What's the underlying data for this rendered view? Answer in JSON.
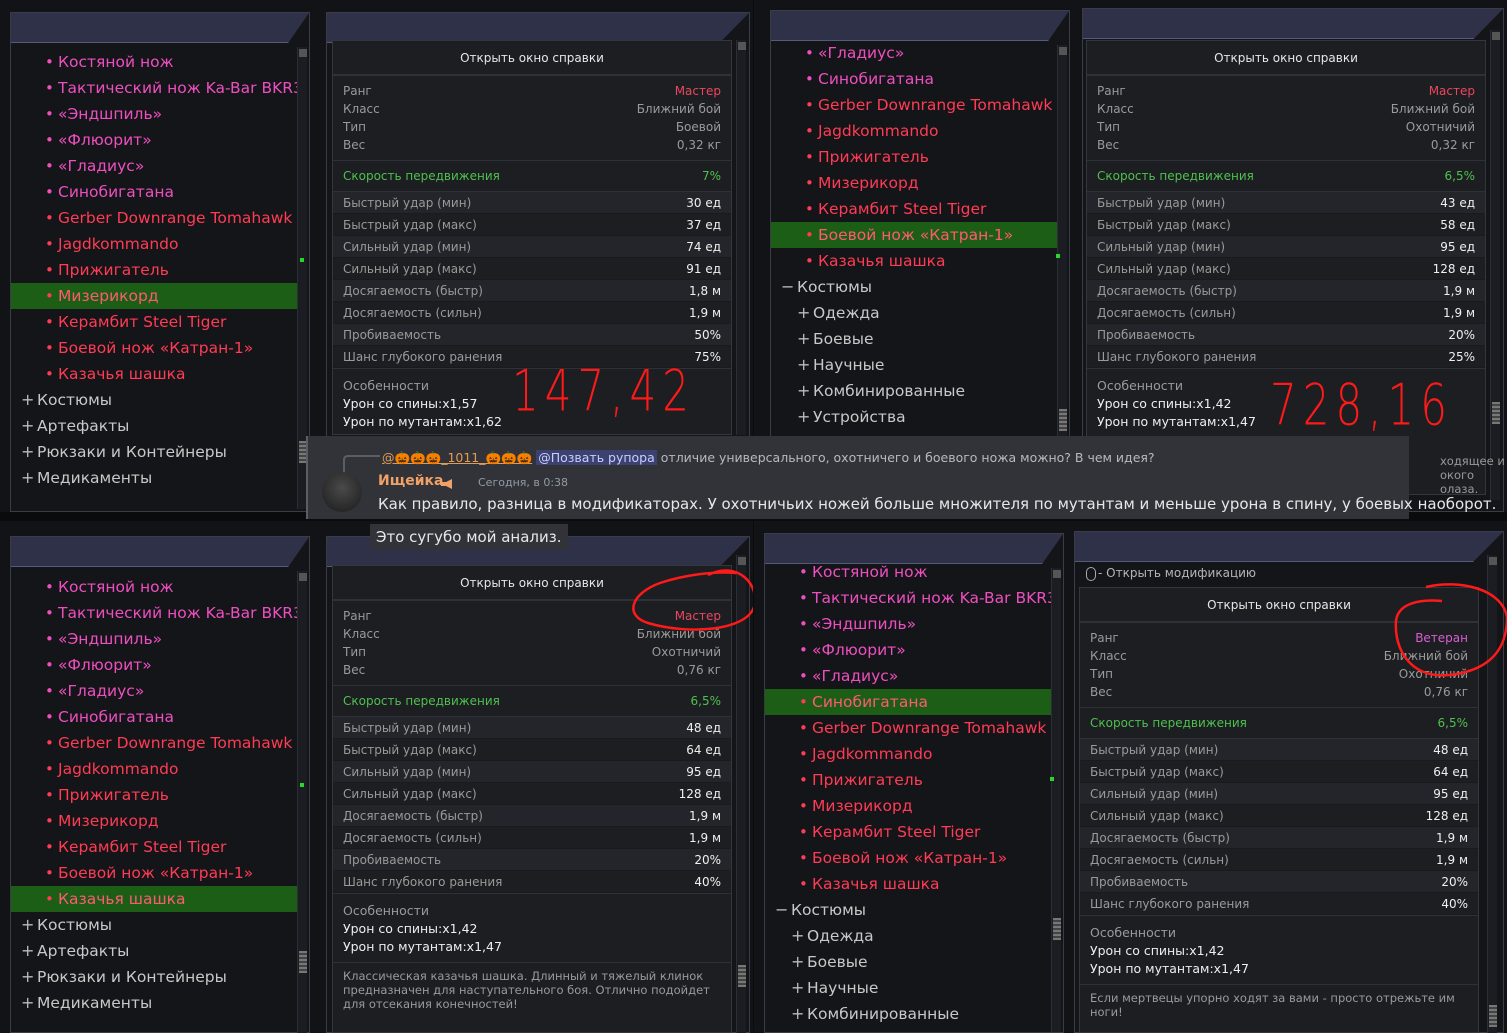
{
  "chat": {
    "reply_author": "@🎃🎃🎃_1011_🎃🎃🎃",
    "reply_mention": "@Позвать рупора",
    "reply_text": "отличие универсального, охотничего и боевого ножа можно? В чем идея?",
    "username": "Ищейка",
    "timestamp": "Сегодня, в 0:38",
    "message": "Как правило, разница в модификаторах. У охотничьих ножей больше множителя по мутантам и меньше урона в спину, у боевых наоборот.",
    "message2": "Это сугубо мой анализ."
  },
  "labels": {
    "open_help": "Открыть окно справки",
    "open_mod": "- Открыть модификацию",
    "rank": "Ранг",
    "class": "Класс",
    "type": "Тип",
    "weight": "Вес",
    "speed": "Скорость передвижения",
    "fast_min": "Быстрый удар (мин)",
    "fast_max": "Быстрый удар (макс)",
    "strong_min": "Сильный удар (мин)",
    "strong_max": "Сильный удар (макс)",
    "reach_fast": "Досягаемость (быстр)",
    "reach_strong": "Досягаемость (сильн)",
    "pierce": "Пробиваемость",
    "bleed": "Шанс глубокого ранения",
    "features": "Особенности",
    "back": "Урон со спины:",
    "mutants": "Урон по мутантам:"
  },
  "panels": {
    "tl": {
      "list": [
        {
          "t": "Костяной нож",
          "c": "pink"
        },
        {
          "t": "Тактический нож Ka-Bar BKR3",
          "c": "pink"
        },
        {
          "t": "«Эндшпиль»",
          "c": "pink"
        },
        {
          "t": "«Флюорит»",
          "c": "pink"
        },
        {
          "t": "«Гладиус»",
          "c": "pink"
        },
        {
          "t": "Синобигатана",
          "c": "pink"
        },
        {
          "t": "Gerber Downrange Tomahawk",
          "c": "red"
        },
        {
          "t": "Jagdkommando",
          "c": "red"
        },
        {
          "t": "Прижигатель",
          "c": "red"
        },
        {
          "t": "Мизерикорд",
          "c": "sel"
        },
        {
          "t": "Керамбит Steel Tiger",
          "c": "red"
        },
        {
          "t": "Боевой нож «Катран-1»",
          "c": "red"
        },
        {
          "t": "Казачья шашка",
          "c": "red"
        },
        {
          "t": "Костюмы",
          "c": "cat",
          "pm": "+"
        },
        {
          "t": "Артефакты",
          "c": "cat",
          "pm": "+"
        },
        {
          "t": "Рюкзаки и Контейнеры",
          "c": "cat",
          "pm": "+"
        },
        {
          "t": "Медикаменты",
          "c": "cat",
          "pm": "+"
        }
      ],
      "rank": "Мастер",
      "class": "Ближний бой",
      "type": "Боевой",
      "weight": "0,32 кг",
      "speed": "7%",
      "stats": [
        "30 ед",
        "37 ед",
        "74 ед",
        "91 ед",
        "1,8 м",
        "1,9 м",
        "50%",
        "75%"
      ],
      "back": "x1,57",
      "mutants": "x1,62",
      "note": "147,42"
    },
    "tr": {
      "list": [
        {
          "t": "«Гладиус»",
          "c": "pink"
        },
        {
          "t": "Синобигатана",
          "c": "pink"
        },
        {
          "t": "Gerber Downrange Tomahawk",
          "c": "red"
        },
        {
          "t": "Jagdkommando",
          "c": "red"
        },
        {
          "t": "Прижигатель",
          "c": "red"
        },
        {
          "t": "Мизерикорд",
          "c": "red"
        },
        {
          "t": "Керамбит Steel Tiger",
          "c": "red"
        },
        {
          "t": "Боевой нож «Катран-1»",
          "c": "sel"
        },
        {
          "t": "Казачья шашка",
          "c": "red"
        },
        {
          "t": "Костюмы",
          "c": "cat",
          "pm": "−"
        },
        {
          "t": "Одежда",
          "c": "sub",
          "pm": "+"
        },
        {
          "t": "Боевые",
          "c": "sub",
          "pm": "+"
        },
        {
          "t": "Научные",
          "c": "sub",
          "pm": "+"
        },
        {
          "t": "Комбинированные",
          "c": "sub",
          "pm": "+"
        },
        {
          "t": "Устройства",
          "c": "sub",
          "pm": "+"
        }
      ],
      "rank": "Мастер",
      "class": "Ближний бой",
      "type": "Охотничий",
      "weight": "0,32 кг",
      "speed": "6,5%",
      "stats": [
        "43 ед",
        "58 ед",
        "95 ед",
        "128 ед",
        "1,9 м",
        "1,9 м",
        "20%",
        "25%"
      ],
      "back": "x1,42",
      "mutants": "x1,47",
      "note": "728,16",
      "desc_frag": "ходящее и\nокого\nолаза."
    },
    "bl": {
      "list": [
        {
          "t": "Костяной нож",
          "c": "pink"
        },
        {
          "t": "Тактический нож Ka-Bar BKR3",
          "c": "pink"
        },
        {
          "t": "«Эндшпиль»",
          "c": "pink"
        },
        {
          "t": "«Флюорит»",
          "c": "pink"
        },
        {
          "t": "«Гладиус»",
          "c": "pink"
        },
        {
          "t": "Синобигатана",
          "c": "pink"
        },
        {
          "t": "Gerber Downrange Tomahawk",
          "c": "red"
        },
        {
          "t": "Jagdkommando",
          "c": "red"
        },
        {
          "t": "Прижигатель",
          "c": "red"
        },
        {
          "t": "Мизерикорд",
          "c": "red"
        },
        {
          "t": "Керамбит Steel Tiger",
          "c": "red"
        },
        {
          "t": "Боевой нож «Катран-1»",
          "c": "red"
        },
        {
          "t": "Казачья шашка",
          "c": "sel"
        },
        {
          "t": "Костюмы",
          "c": "cat",
          "pm": "+"
        },
        {
          "t": "Артефакты",
          "c": "cat",
          "pm": "+"
        },
        {
          "t": "Рюкзаки и Контейнеры",
          "c": "cat",
          "pm": "+"
        },
        {
          "t": "Медикаменты",
          "c": "cat",
          "pm": "+"
        }
      ],
      "rank": "Мастер",
      "class": "Ближний бой",
      "type": "Охотничий",
      "weight": "0,76 кг",
      "speed": "6,5%",
      "stats": [
        "48 ед",
        "64 ед",
        "95 ед",
        "128 ед",
        "1,9 м",
        "1,9 м",
        "20%",
        "40%"
      ],
      "back": "x1,42",
      "mutants": "x1,47",
      "desc": "Классическая казачья шашка. Длинный и тяжелый клинок предназначен для наступательного боя. Отлично подойдет для отсекания конечностей!"
    },
    "br": {
      "list": [
        {
          "t": "Костяной нож",
          "c": "pink"
        },
        {
          "t": "Тактический нож Ka-Bar BKR3",
          "c": "pink"
        },
        {
          "t": "«Эндшпиль»",
          "c": "pink"
        },
        {
          "t": "«Флюорит»",
          "c": "pink"
        },
        {
          "t": "«Гладиус»",
          "c": "pink"
        },
        {
          "t": "Синобигатана",
          "c": "sel"
        },
        {
          "t": "Gerber Downrange Tomahawk",
          "c": "red"
        },
        {
          "t": "Jagdkommando",
          "c": "red"
        },
        {
          "t": "Прижигатель",
          "c": "red"
        },
        {
          "t": "Мизерикорд",
          "c": "red"
        },
        {
          "t": "Керамбит Steel Tiger",
          "c": "red"
        },
        {
          "t": "Боевой нож «Катран-1»",
          "c": "red"
        },
        {
          "t": "Казачья шашка",
          "c": "red"
        },
        {
          "t": "Костюмы",
          "c": "cat",
          "pm": "−"
        },
        {
          "t": "Одежда",
          "c": "sub",
          "pm": "+"
        },
        {
          "t": "Боевые",
          "c": "sub",
          "pm": "+"
        },
        {
          "t": "Научные",
          "c": "sub",
          "pm": "+"
        },
        {
          "t": "Комбинированные",
          "c": "sub",
          "pm": "+"
        }
      ],
      "rank": "Ветеран",
      "class": "Ближний бой",
      "type": "Охотничий",
      "weight": "0,76 кг",
      "speed": "6,5%",
      "stats": [
        "48 ед",
        "64 ед",
        "95 ед",
        "128 ед",
        "1,9 м",
        "1,9 м",
        "20%",
        "40%"
      ],
      "back": "x1,42",
      "mutants": "x1,47",
      "desc": "Если мертвецы упорно ходят за вами - просто отрежьте им ноги!"
    }
  }
}
